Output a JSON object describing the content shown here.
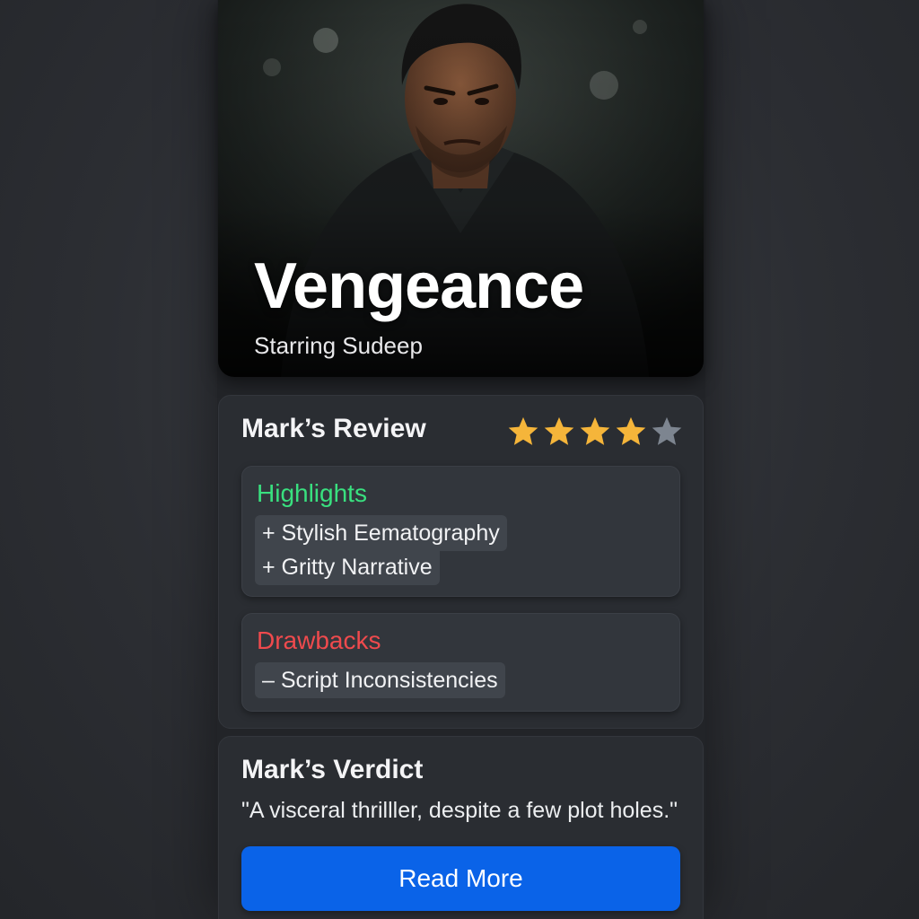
{
  "hero": {
    "title": "Vengeance",
    "subtitle": "Starring Sudeep"
  },
  "review": {
    "title": "Mark’s Review",
    "rating": 4,
    "rating_max": 5,
    "star_filled_color": "#f5b53a",
    "star_empty_color": "#7d8590",
    "highlights": {
      "heading": "Highlights",
      "heading_color": "#39e07f",
      "items": [
        "+ Stylish Eematography",
        "+ Gritty Narrative"
      ]
    },
    "drawbacks": {
      "heading": "Drawbacks",
      "heading_color": "#ef4a4d",
      "items": [
        "– Script Inconsistencies"
      ]
    }
  },
  "verdict": {
    "title": "Mark’s Verdict",
    "quote": "\"A visceral thrilller, despite a few plot holes.\"",
    "button_label": "Read More",
    "button_color": "#0a63e8"
  }
}
